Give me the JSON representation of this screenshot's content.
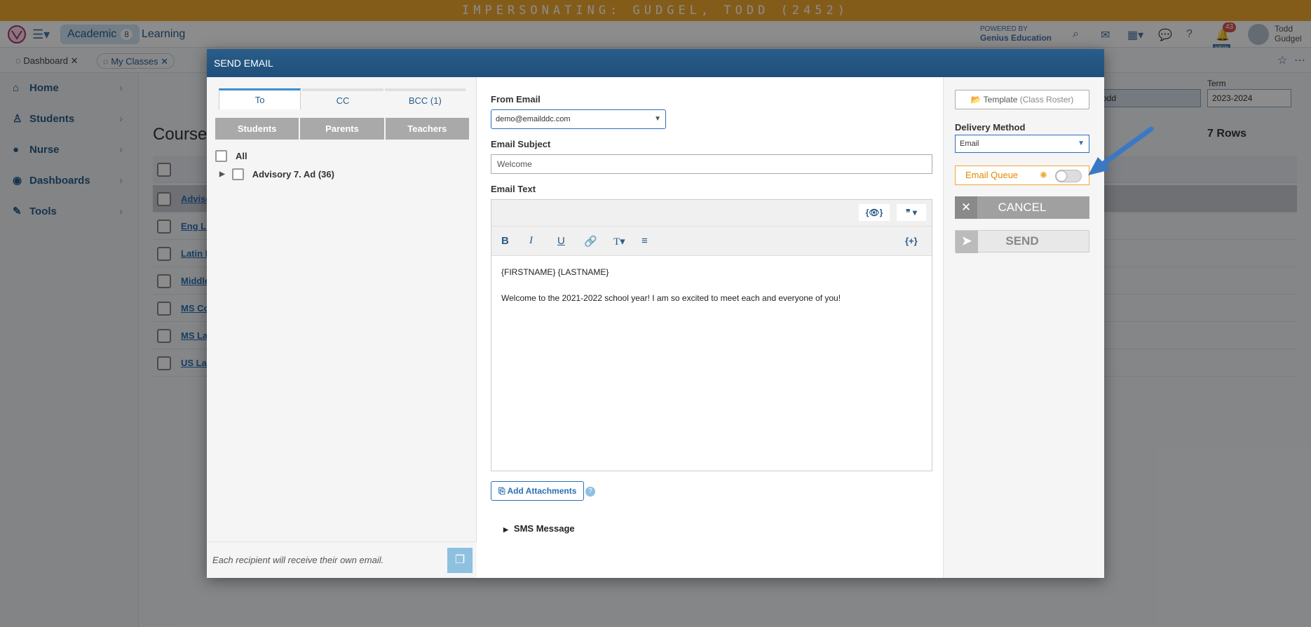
{
  "impersonation": "IMPERSONATING: GUDGEL, TODD (2452)",
  "topnav": {
    "app_tab": "Academic",
    "app_badge": "8",
    "learning": "Learning",
    "powered_line1": "POWERED BY",
    "powered_line2": "Genius Education",
    "notif_count": "43",
    "new_tag": "NEW",
    "user_first": "Todd",
    "user_last": "Gudgel"
  },
  "tabs": [
    {
      "label": "Dashboard"
    },
    {
      "label": "My Classes"
    }
  ],
  "sidebar": {
    "items": [
      {
        "label": "Home",
        "icon": "home-icon"
      },
      {
        "label": "Students",
        "icon": "student-icon"
      },
      {
        "label": "Nurse",
        "icon": "user-icon"
      },
      {
        "label": "Dashboards",
        "icon": "dashboard-icon"
      },
      {
        "label": "Tools",
        "icon": "wrench-icon"
      }
    ]
  },
  "main": {
    "title": "Course",
    "rows_label": "7 Rows",
    "term_label": "Term",
    "term_value": "2023-2024",
    "filter_value": "odd",
    "rows": [
      {
        "link": "Adviso"
      },
      {
        "link": "Eng Li"
      },
      {
        "link": "Latin I"
      },
      {
        "link": "Middle"
      },
      {
        "link": "MS Co"
      },
      {
        "link": "MS La"
      },
      {
        "link": "US Lat"
      }
    ]
  },
  "modal": {
    "title": "SEND EMAIL",
    "recipient_tabs": [
      {
        "label": "To"
      },
      {
        "label": "CC"
      },
      {
        "label": "BCC (1)"
      }
    ],
    "group_buttons": [
      {
        "label": "Students"
      },
      {
        "label": "Parents"
      },
      {
        "label": "Teachers"
      }
    ],
    "all_label": "All",
    "group_label": "Advisory 7. Ad (36)",
    "footer_note": "Each recipient will receive their own email.",
    "from_label": "From Email",
    "from_value": "demo@emailddc.com",
    "subject_label": "Email Subject",
    "subject_value": "Welcome",
    "text_label": "Email Text",
    "preview_btn": "{👁}",
    "quote_btn": "❞ ▾",
    "insert_btn": "{+}",
    "body_line1": "{FIRSTNAME} {LASTNAME}",
    "body_line2": "Welcome to the 2021-2022 school year! I am so excited to meet each and everyone of you!",
    "attach_label": "Add Attachments",
    "sms_label": "SMS Message",
    "template_label": "Template",
    "template_sub": "(Class Roster)",
    "delivery_label": "Delivery Method",
    "delivery_value": "Email",
    "queue_label": "Email Queue",
    "cancel_label": "CANCEL",
    "send_label": "SEND"
  },
  "colors": {
    "impersonation": "#f0a830",
    "header": "#2a5d8a",
    "accent": "#3d8ccf",
    "arrow": "#3b78c4"
  }
}
